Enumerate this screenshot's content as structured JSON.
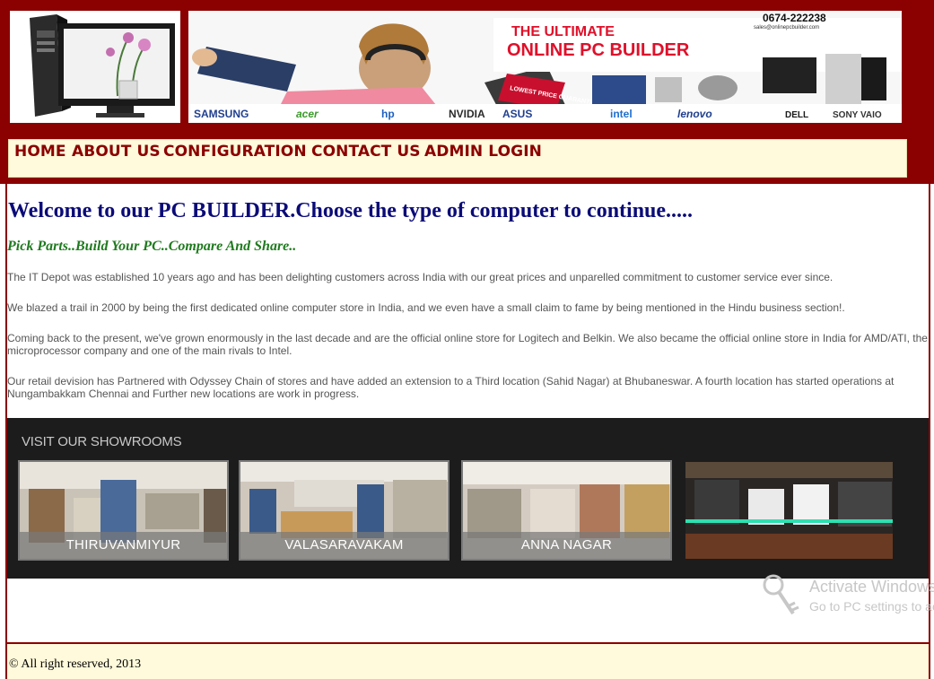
{
  "banner": {
    "headline_line1": "THE ULTIMATE",
    "headline_line2": "ONLINE PC BUILDER",
    "phone": "0674-222238",
    "email": "sales@onlinepcbuilder.com",
    "badge": "LOWEST PRICE GUARANTEE",
    "brands": [
      "SAMSUNG",
      "acer",
      "hp",
      "NVIDIA",
      "ASUS",
      "intel",
      "lenovo",
      "DELL",
      "SONY VAIO"
    ]
  },
  "nav": {
    "items": [
      {
        "label": "HOME"
      },
      {
        "label": "ABOUT US"
      },
      {
        "label": "CONFIGURATION"
      },
      {
        "label": "CONTACT US"
      },
      {
        "label": "ADMIN LOGIN"
      }
    ]
  },
  "main": {
    "title": "Welcome to our PC BUILDER.Choose the type of computer to continue.....",
    "tagline": "Pick Parts..Build Your PC..Compare And Share..",
    "paragraphs": [
      "The IT Depot was established 10 years ago and has been delighting customers across India with our great prices and unparelled commitment to customer service ever since.",
      "We blazed a trail in 2000 by being the first dedicated online computer store in India, and we even have a small claim to fame by being mentioned in the Hindu business section!.",
      "Coming back to the present, we've grown enormously in the last decade and are the official online store for Logitech and Belkin. We also became the official online store in India for AMD/ATI, the microprocessor company and one of the main rivals to Intel.",
      "Our retail devision has Partnered with Odyssey Chain of stores and have added an extension to a Third location (Sahid Nagar) at Bhubaneswar. A fourth location has started operations at Nungambakkam Chennai and Further new locations are work in progress."
    ]
  },
  "showrooms": {
    "title": "VISIT OUR SHOWROOMS",
    "items": [
      {
        "name": "THIRUVANMIYUR"
      },
      {
        "name": "VALASARAVAKAM"
      },
      {
        "name": "ANNA NAGAR"
      },
      {
        "name": ""
      }
    ]
  },
  "watermark": {
    "title": "Activate Windows",
    "subtitle": "Go to PC settings to activate Windows."
  },
  "footer": {
    "copyright": "© All right reserved, 2013"
  },
  "colors": {
    "header_bg": "#8b0000",
    "nav_bg": "#fffadb",
    "title_color": "#0b0b78",
    "tagline_color": "#1f7a1f",
    "showroom_bg": "#1c1c1c"
  }
}
